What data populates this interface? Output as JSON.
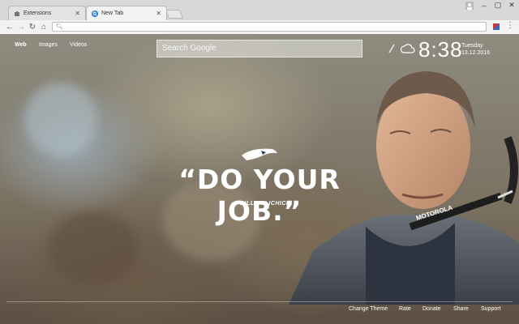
{
  "tabs": [
    {
      "label": "Extensions",
      "icon": "puzzle-icon"
    },
    {
      "label": "New Tab",
      "icon": "search-icon"
    }
  ],
  "toolbar": {
    "url": ""
  },
  "nav": {
    "web": "Web",
    "images": "Images",
    "videos": "Videos"
  },
  "search": {
    "placeholder": "Search Google"
  },
  "clock": {
    "time": "8:38",
    "day": "Tuesday",
    "date": "13.12.2016"
  },
  "quote": {
    "text": "“DO YOUR JOB.”",
    "author": "— BILL BELICHICK"
  },
  "footer": {
    "change_theme": "Change Theme",
    "rate": "Rate",
    "donate": "Donate",
    "share": "Share",
    "support": "Support"
  },
  "colors": {
    "accent": "#ffffff",
    "tab_active": "#f2f2f2"
  }
}
